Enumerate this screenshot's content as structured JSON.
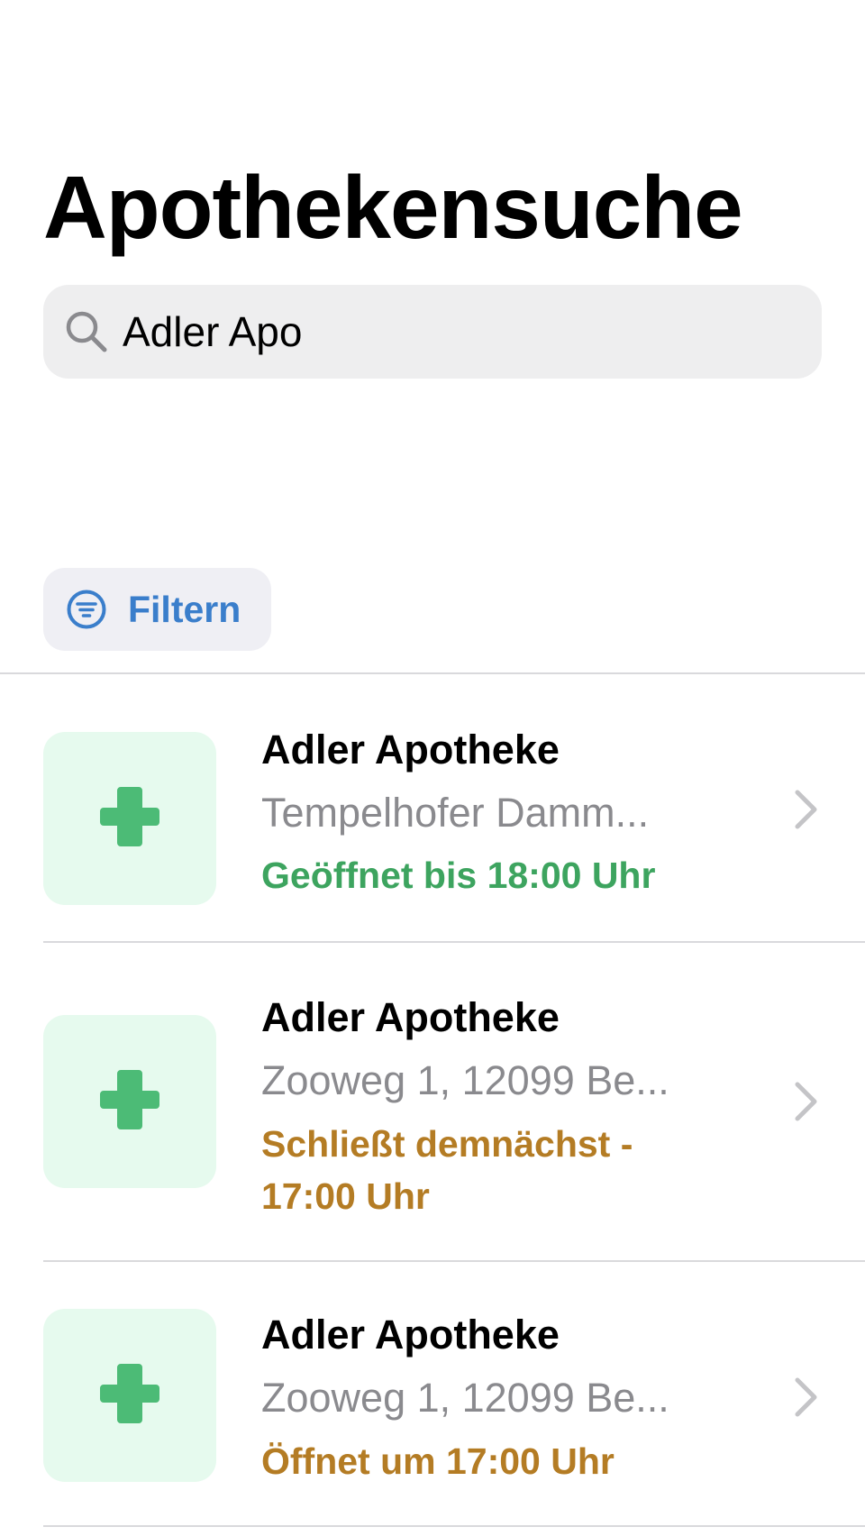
{
  "header": {
    "title": "Apothekensuche"
  },
  "search": {
    "value": "Adler Apo",
    "icon": "search-icon"
  },
  "filter": {
    "label": "Filtern",
    "icon": "filter-icon"
  },
  "colors": {
    "accent": "#3a7ecb",
    "open": "#3da45f",
    "warning": "#b47c24",
    "secondary_text": "#8a8a8e",
    "thumbnail_bg": "#e6faee",
    "cross": "#4cbb76"
  },
  "results": [
    {
      "name": "Adler Apotheke",
      "address": "Tempelhofer Damm...",
      "status": "Geöffnet bis 18:00 Uhr",
      "status_color": "#3da45f",
      "icon": "pharmacy-cross-icon"
    },
    {
      "name": "Adler Apotheke",
      "address": "Zooweg 1, 12099 Be...",
      "status": "Schließt demnächst - 17:00 Uhr",
      "status_color": "#b47c24",
      "icon": "pharmacy-cross-icon"
    },
    {
      "name": "Adler Apotheke",
      "address": "Zooweg 1, 12099 Be...",
      "status": "Öffnet um 17:00 Uhr",
      "status_color": "#b47c24",
      "icon": "pharmacy-cross-icon"
    }
  ]
}
